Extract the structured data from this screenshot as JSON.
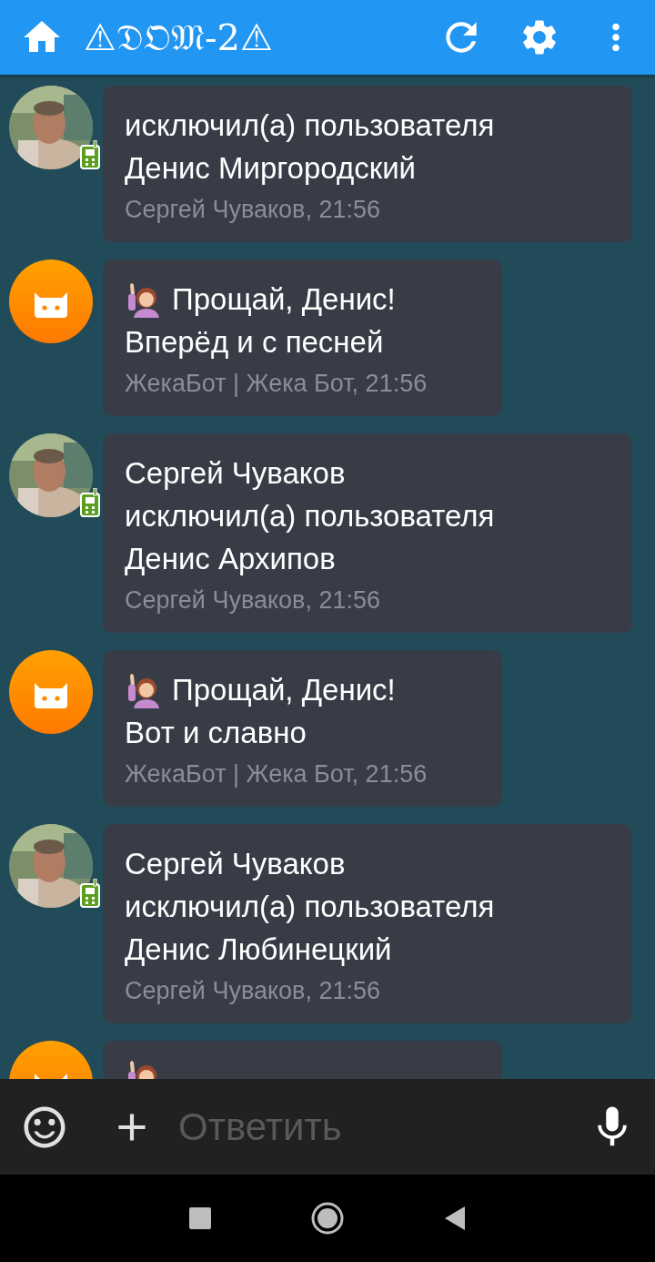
{
  "toolbar": {
    "title": "⚠𝔇𝔒𝔐-2⚠"
  },
  "messages": [
    {
      "kind": "member",
      "lines": [
        "исключил(а) пользователя",
        "Денис Миргородский"
      ],
      "meta": "Сергей Чуваков, 21:56"
    },
    {
      "kind": "bot",
      "lines": [
        "Прощай, Денис!",
        "Вперёд и с песней"
      ],
      "meta": "ЖекаБот | Жека Бот, 21:56"
    },
    {
      "kind": "member",
      "lines": [
        "Сергей Чуваков",
        "исключил(а) пользователя",
        "Денис Архипов"
      ],
      "meta": "Сергей Чуваков, 21:56"
    },
    {
      "kind": "bot",
      "lines": [
        "Прощай, Денис!",
        "Вот и славно"
      ],
      "meta": "ЖекаБот | Жека Бот, 21:56"
    },
    {
      "kind": "member",
      "lines": [
        "Сергей Чуваков",
        "исключил(а) пользователя",
        "Денис Любинецкий"
      ],
      "meta": "Сергей Чуваков, 21:56"
    },
    {
      "kind": "bot"
    }
  ],
  "composer": {
    "placeholder": "Ответить"
  }
}
